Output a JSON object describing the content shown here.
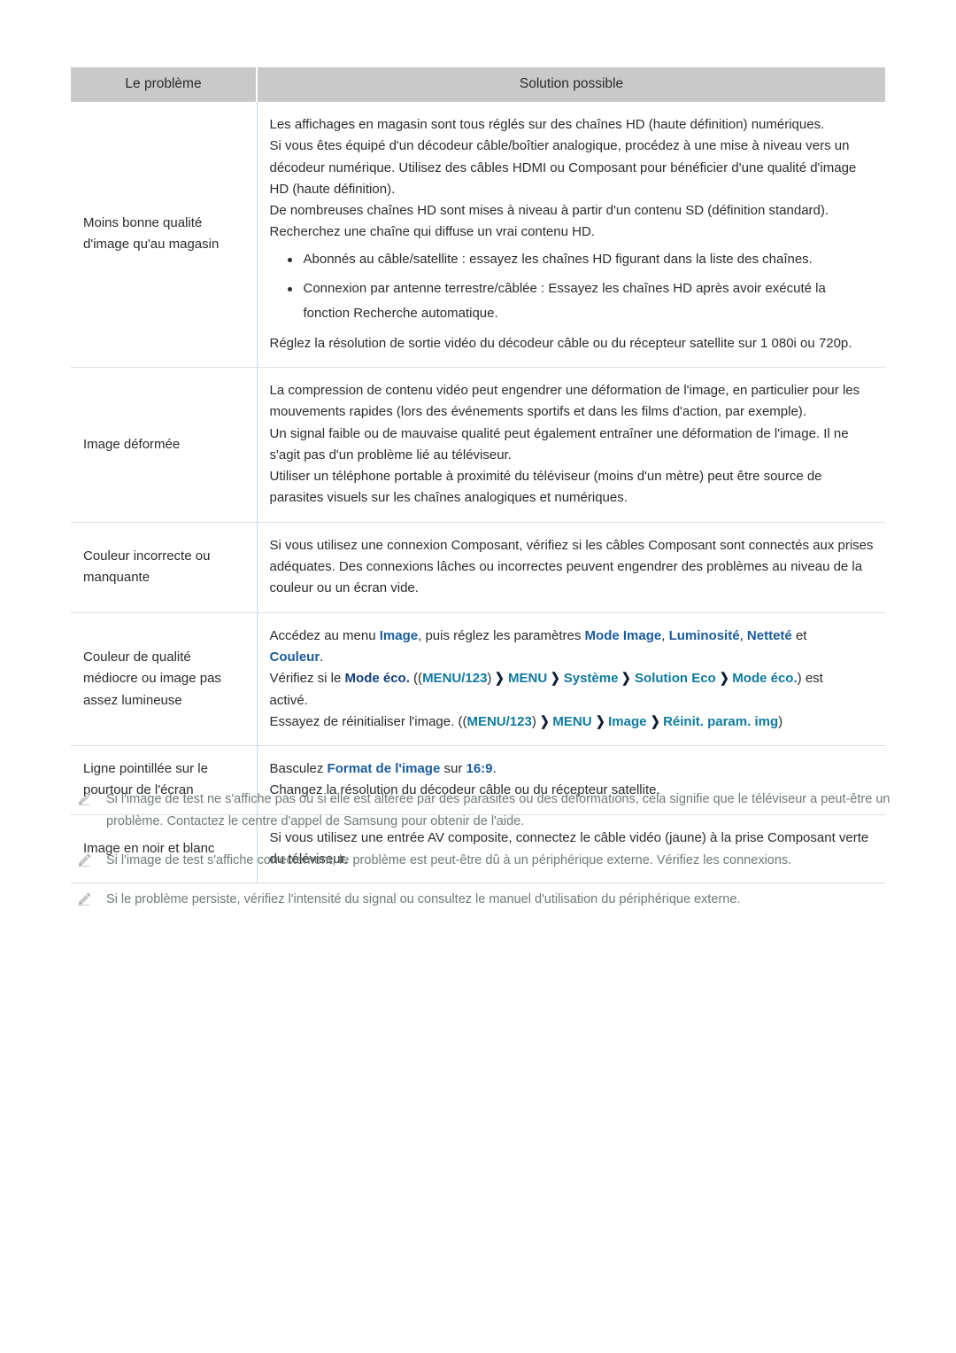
{
  "table": {
    "headers": [
      "Le problème",
      "Solution possible"
    ],
    "rows": [
      {
        "problem": "Moins bonne qualité d'image qu'au magasin",
        "solution_lines": [
          "Les affichages en magasin sont tous réglés sur des chaînes HD (haute définition) numériques.",
          "Si vous êtes équipé d'un décodeur câble/boîtier analogique, procédez à une mise à niveau vers un décodeur numérique. Utilisez des câbles HDMI ou Composant pour bénéficier d'une qualité d'image HD (haute définition).",
          "De nombreuses chaînes HD sont mises à niveau à partir d'un contenu SD (définition standard). Recherchez une chaîne qui diffuse un vrai contenu HD."
        ],
        "bullets": [
          {
            "text": "Abonnés au câble/satellite : essayez les chaînes HD figurant dans la liste des chaînes.",
            "cont": ""
          },
          {
            "text": "Connexion par antenne terrestre/câblée : Essayez les chaînes HD après avoir exécuté la",
            "cont": "fonction Recherche automatique."
          }
        ],
        "tail_lines": [
          "Réglez la résolution de sortie vidéo du décodeur câble ou du récepteur satellite sur 1 080i ou 720p."
        ]
      },
      {
        "problem": "Image déformée",
        "solution_lines": [
          "La compression de contenu vidéo peut engendrer une déformation de l'image, en particulier pour les mouvements rapides (lors des événements sportifs et dans les films d'action, par exemple).",
          "Un signal faible ou de mauvaise qualité peut également entraîner une déformation de l'image. Il ne s'agit pas d'un problème lié au téléviseur.",
          "Utiliser un téléphone portable à proximité du téléviseur (moins d'un mètre) peut être source de parasites visuels sur les chaînes analogiques et numériques."
        ]
      },
      {
        "problem": "Couleur incorrecte ou manquante",
        "solution_lines": [
          "Si vous utilisez une connexion Composant, vérifiez si les câbles Composant sont connectés aux prises adéquates. Des connexions lâches ou incorrectes peuvent engendrer des problèmes au niveau de la couleur ou un écran vide."
        ]
      },
      {
        "problem": "Couleur de qualité médiocre ou image pas assez lumineuse",
        "rich": {
          "l1_a": "Accédez au menu ",
          "l1_image": "Image",
          "l1_b": ", puis réglez les paramètres ",
          "l1_mode": "Mode Image",
          "l1_c": ", ",
          "l1_lum": "Luminosité",
          "l1_d": ", ",
          "l1_net": "Netteté",
          "l1_e": " et",
          "l2_couleur": "Couleur",
          "l2_dot": ".",
          "l3_a": "Vérifiez si le ",
          "l3_modeeco": "Mode éco.",
          "l3_paren_open": " ((",
          "l3_menu123": "MENU/123",
          "l3_paren_close": ")",
          "l3_menu": "MENU",
          "l3_systeme": "Système",
          "l3_solutioneco": "Solution Eco",
          "l3_modeeco2": "Mode éco.",
          "l3_end": ") est",
          "l4": "activé.",
          "l5_a": "Essayez de réinitialiser l'image. ((",
          "l5_menu123": "MENU/123",
          "l5_paren_close": ")",
          "l5_menu": "MENU",
          "l5_image": "Image",
          "l5_reinit": "Réinit. param. img",
          "l5_end": ")"
        }
      },
      {
        "problem": "Ligne pointillée sur le pourtour de l'écran",
        "rich2": {
          "l1_a": "Basculez ",
          "l1_format": "Format de l'image",
          "l1_b": " sur ",
          "l1_169": "16:9",
          "l1_c": ".",
          "l2": "Changez la résolution du décodeur câble ou du récepteur satellite."
        }
      },
      {
        "problem": "Image en noir et blanc",
        "solution_lines": [
          "Si vous utilisez une entrée AV composite, connectez le câble vidéo (jaune) à la prise Composant verte du téléviseur."
        ]
      }
    ]
  },
  "notes": [
    "Si l'image de test ne s'affiche pas ou si elle est altérée par des parasites ou des déformations, cela signifie que le téléviseur a peut-être un problème. Contactez le centre d'appel de Samsung pour obtenir de l'aide.",
    "Si l'image de test s'affiche correctement, le problème est peut-être dû à un périphérique externe. Vérifiez les connexions.",
    "Si le problème persiste, vérifiez l'intensité du signal ou consultez le manuel d'utilisation du périphérique externe."
  ],
  "colors": {
    "header_bg": "#c9c9c9",
    "accent_blue": "#1a5c9c",
    "accent_teal": "#0f7a9e",
    "accent_navy": "#13407a",
    "note_text": "#6f7b78",
    "column_divider": "#c3dde6",
    "row_divider": "#dcdee1"
  },
  "icons": {
    "bullet": "round-bullet",
    "note": "pencil-icon",
    "separator": "chevron-right-icon"
  }
}
